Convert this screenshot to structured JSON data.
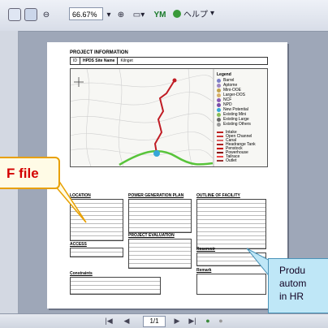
{
  "toolbar": {
    "zoom_value": "66.67%",
    "help_label": "ヘルプ"
  },
  "page": {
    "title": "PROJECT INFORMATION",
    "id_label": "ID",
    "name_label": "HPDS Site Name",
    "name_value": "Kilnget",
    "legend": {
      "title": "Legend",
      "items": [
        {
          "label": "Barrel",
          "color": "#7a7fc7"
        },
        {
          "label": "Aptome",
          "color": "#9e86c2"
        },
        {
          "label": "Mini-OOE",
          "color": "#c4a24a"
        },
        {
          "label": "Larger-DOS",
          "color": "#d7b06a"
        },
        {
          "label": "NCF",
          "color": "#8a5ab5"
        },
        {
          "label": "NPD",
          "color": "#7b4ea8"
        },
        {
          "label": "New Potential",
          "color": "#35a7d8"
        },
        {
          "label": "Existing Mini",
          "color": "#8bbd5a"
        },
        {
          "label": "Existing Large",
          "color": "#6a6a6a"
        },
        {
          "label": "Existing Others",
          "color": "#9a9a9a"
        }
      ],
      "lines": [
        {
          "label": "Intake",
          "color": "#b22"
        },
        {
          "label": "Open Channel",
          "color": "#c33"
        },
        {
          "label": "Canal",
          "color": "#d66"
        },
        {
          "label": "Headrange Tank",
          "color": "#a22"
        },
        {
          "label": "Penstock",
          "color": "#c00"
        },
        {
          "label": "Powerhouse",
          "color": "#800"
        },
        {
          "label": "Tailrace",
          "color": "#e44"
        },
        {
          "label": "Outlet",
          "color": "#933"
        }
      ]
    },
    "sections": {
      "location": "LOCATION",
      "power": "POWER GENERATION PLAN",
      "outline": "OUTLINE OF FACILITY",
      "access": "ACCESS",
      "project_eval": "PROJECT EVALUATION",
      "reservoir": "Reservoir",
      "constraints": "Constraints",
      "remark": "Remark"
    }
  },
  "bottombar": {
    "page_indicator": "1/1"
  },
  "callouts": {
    "left_text": "F file",
    "right_lines": [
      "Produ",
      "autom",
      "in HR"
    ]
  }
}
